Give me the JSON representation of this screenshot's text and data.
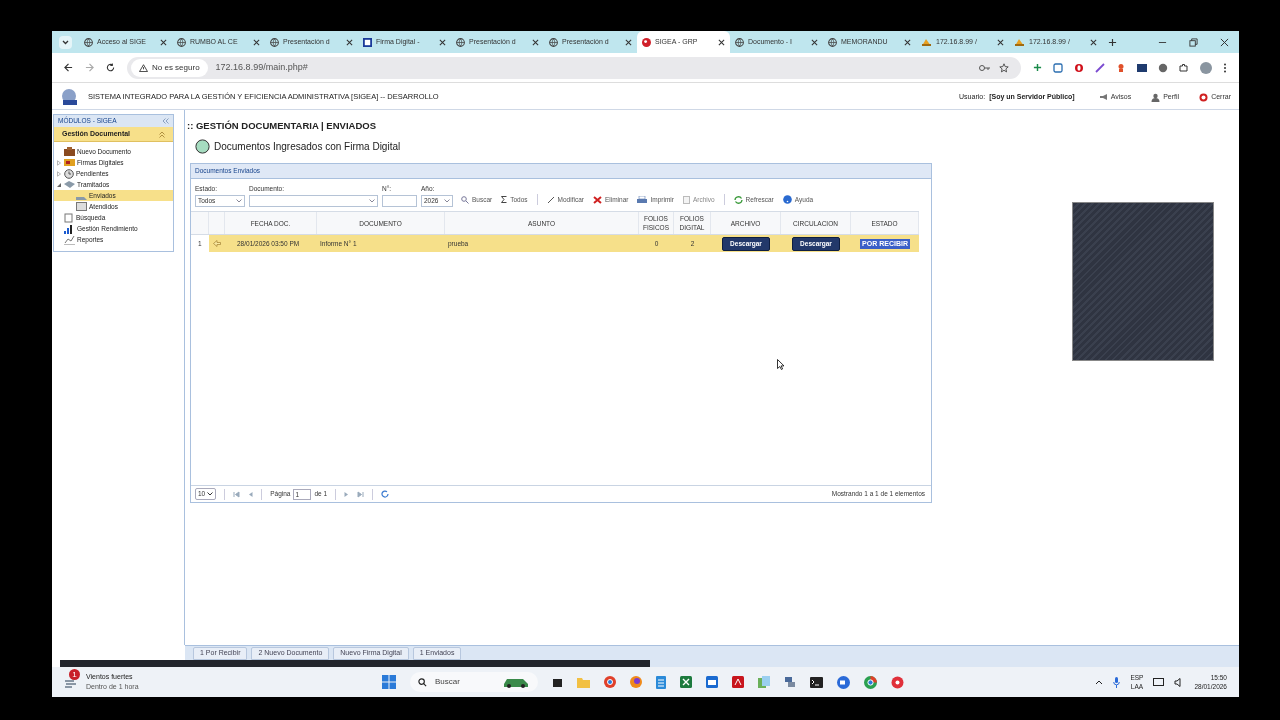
{
  "browser": {
    "tabs": [
      {
        "title": "Acceso al SIGE",
        "kind": "globe",
        "selected": false
      },
      {
        "title": "RUMBO AL CE",
        "kind": "globe",
        "selected": false
      },
      {
        "title": "Presentación d",
        "kind": "globe",
        "selected": false
      },
      {
        "title": "Firma Digital -",
        "kind": "doc",
        "selected": false
      },
      {
        "title": "Presentación d",
        "kind": "globe",
        "selected": false
      },
      {
        "title": "Presentación d",
        "kind": "globe",
        "selected": false
      },
      {
        "title": "SIGEA - GRP",
        "kind": "red",
        "selected": true
      },
      {
        "title": "Documento - I",
        "kind": "globe",
        "selected": false
      },
      {
        "title": "MEMORANDU",
        "kind": "globe",
        "selected": false
      },
      {
        "title": "172.16.8.99 /",
        "kind": "pma",
        "selected": false
      },
      {
        "title": "172.16.8.99 /",
        "kind": "pma",
        "selected": false
      }
    ],
    "not_secure": "No es seguro",
    "address": "172.16.8.99/main.php#"
  },
  "header": {
    "title": "SISTEMA INTEGRADO PARA LA GESTIÓN Y EFICIENCIA ADMINISTRATIVA [SIGEA] -- DESARROLLO",
    "user_label": "Usuario:",
    "user": "[Soy un Servidor Público]",
    "links": [
      "Avisos",
      "Perfil",
      "Cerrar"
    ]
  },
  "sidebar": {
    "title": "MÓDULOS - SIGEA",
    "section": "Gestión Documental",
    "items": [
      {
        "label": "Nuevo Documento",
        "selected": false
      },
      {
        "label": "Firmas Digitales",
        "selected": false,
        "expanded": false
      },
      {
        "label": "Pendientes",
        "selected": false,
        "expanded": false
      },
      {
        "label": "Tramitados",
        "selected": false,
        "expanded": true,
        "children": [
          {
            "label": "Enviados",
            "selected": true
          },
          {
            "label": "Atendidos",
            "selected": false
          }
        ]
      },
      {
        "label": "Búsqueda",
        "selected": false
      },
      {
        "label": "Gestión Rendimiento",
        "selected": false
      },
      {
        "label": "Reportes",
        "selected": false
      }
    ]
  },
  "main": {
    "title": ":: GESTIÓN DOCUMENTARIA | ENVIADOS",
    "subtitle": "Documentos Ingresados con Firma Digital",
    "panel_title": "Documentos Enviados",
    "filters": [
      {
        "label": "Estado:",
        "value": "Todos"
      },
      {
        "label": "Documento:"
      },
      {
        "label": "N°:"
      },
      {
        "label": "Año:",
        "value": "2026"
      }
    ],
    "toolbar": [
      "Buscar",
      "Todos",
      "Modificar",
      "Eliminar",
      "Imprimir",
      "Archivo",
      "Refrescar",
      "Ayuda"
    ],
    "columns": [
      "FECHA DOC.",
      "DOCUMENTO",
      "ASUNTO",
      "FOLIOS FISICOS",
      "FOLIOS DIGITAL",
      "ARCHIVO",
      "CIRCULACION",
      "ESTADO"
    ],
    "rows": [
      {
        "number": "1",
        "selected": true,
        "fecha": "28/01/2026 03:50 PM",
        "documento": "Informe N° 1",
        "asunto": "prueba",
        "folios_fisicos": "0",
        "folios_digital": "2",
        "archivo": "Descargar",
        "circulacion": "Descargar",
        "estado": "POR RECIBIR"
      }
    ],
    "pager": {
      "page_size": "10",
      "page_label": "Página",
      "page": "1",
      "of": "de 1",
      "summary": "Mostrando 1 a 1 de 1 elementos"
    }
  },
  "bottom_tabs": [
    "1 Por Recibir",
    "2 Nuevo Documento",
    "Nuevo Firma Digital",
    "1 Enviados"
  ],
  "taskbar": {
    "weather": "Vientos fuertes",
    "weather_sub": "Dentro de 1 hora",
    "badge": "1",
    "search": "Buscar",
    "lang": "ESP",
    "layout": "LAA",
    "time": "15:50",
    "date": "28/01/2026"
  }
}
